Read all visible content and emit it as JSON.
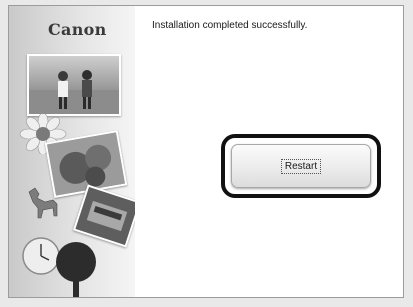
{
  "sidebar": {
    "brand": "Canon"
  },
  "main": {
    "message": "Installation completed successfully.",
    "restart_label": "Restart"
  },
  "colors": {
    "highlight_outline": "#111111",
    "background": "#ffffff"
  }
}
